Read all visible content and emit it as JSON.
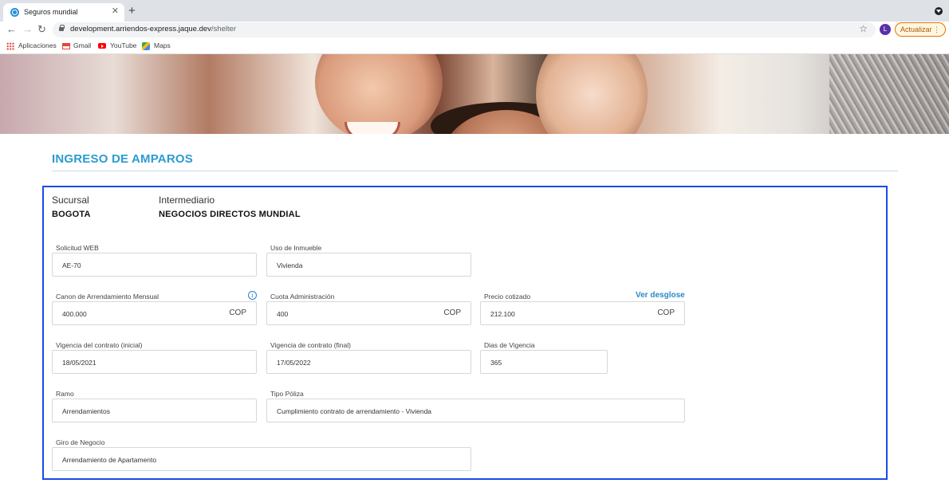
{
  "browser": {
    "tab_title": "Seguros mundial",
    "tab_close": "✕",
    "new_tab": "+",
    "url_host": "development.arriendos-express.jaque.dev",
    "url_path": "/shelter",
    "avatar_letter": "L",
    "update_label": "Actualizar",
    "update_menu": "⋮",
    "back": "←",
    "forward": "→",
    "reload": "↻",
    "star": "☆",
    "bookmarks": [
      {
        "label": "Aplicaciones",
        "icon": "apps-icon"
      },
      {
        "label": "Gmail",
        "icon": "gmail-icon"
      },
      {
        "label": "YouTube",
        "icon": "youtube-icon"
      },
      {
        "label": "Maps",
        "icon": "maps-icon"
      }
    ]
  },
  "page": {
    "title": "INGRESO DE AMPAROS",
    "title_color": "#2b9bd3",
    "panel_border_color": "#1d4ae6",
    "sucursal": {
      "label": "Sucursal",
      "value": "BOGOTA"
    },
    "intermediario": {
      "label": "Intermediario",
      "value": "NEGOCIOS DIRECTOS MUNDIAL"
    },
    "fields": {
      "solicitud_web": {
        "label": "Solicitud WEB",
        "value": "AE-70"
      },
      "uso_inmueble": {
        "label": "Uso de Inmueble",
        "value": "Vivienda"
      },
      "canon": {
        "label": "Canon de Arrendamiento Mensual",
        "value": "400.000",
        "suffix": "COP",
        "info": "i"
      },
      "cuota_admin": {
        "label": "Cuota Administración",
        "value": "400",
        "suffix": "COP"
      },
      "precio": {
        "label": "Precio cotizado",
        "value": "212.100",
        "suffix": "COP",
        "link": "Ver desglose"
      },
      "vigencia_inicial": {
        "label": "Vigencia del contrato (inicial)",
        "value": "18/05/2021"
      },
      "vigencia_final": {
        "label": "Vigencia de contrato (final)",
        "value": "17/05/2022"
      },
      "dias_vigencia": {
        "label": "Dias de Vigencia",
        "value": "365"
      },
      "ramo": {
        "label": "Ramo",
        "value": "Arrendamientos"
      },
      "tipo_poliza": {
        "label": "Tipo Póliza",
        "value": "Cumplimiento contrato de arrendamiento - Vivienda"
      },
      "giro_negocio": {
        "label": "Giro de Negocio",
        "value": "Arrendamiento de Apartamento"
      }
    }
  }
}
